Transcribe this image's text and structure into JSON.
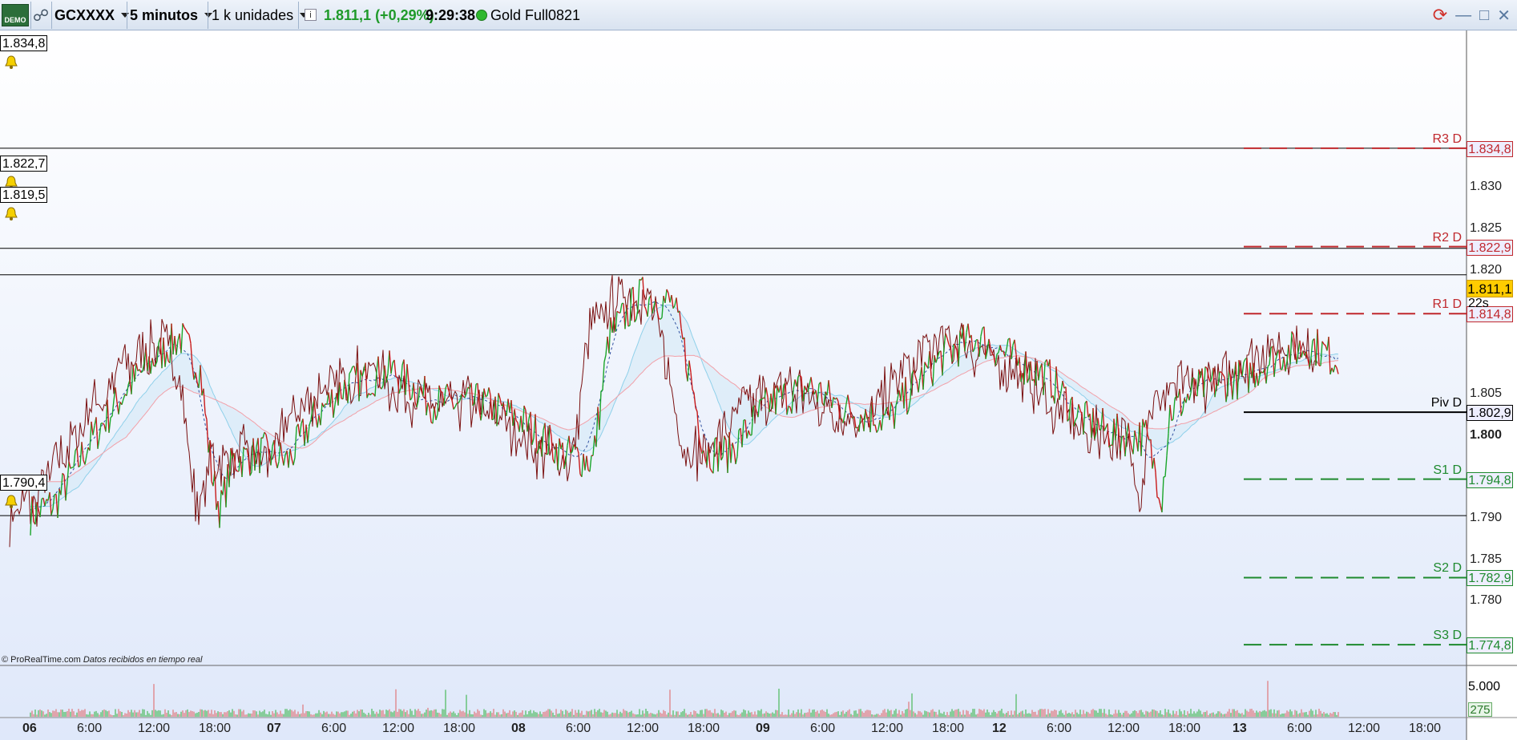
{
  "toolbar": {
    "demo_label": "DEMO",
    "ticker": "GCXXXX",
    "timeframe": "5 minutos",
    "units": "1 k unidades",
    "info_label": "i",
    "price_change": "1.811,1 (+0,29%)",
    "time": "9:29:38",
    "instrument": "Gold Full0821",
    "colors": {
      "up": "#1f9a2a",
      "status": "#2eb82e"
    }
  },
  "levels": {
    "alert_1": "1.834,8",
    "alert_2": "1.822,7",
    "alert_3": "1.819,5",
    "alert_4": "1.790,4"
  },
  "pivots": [
    {
      "label": "R3 D",
      "value": "1.834,8",
      "price": 1834.8,
      "color": "#c0282d"
    },
    {
      "label": "R2 D",
      "value": "1.822,9",
      "price": 1822.9,
      "color": "#c0282d"
    },
    {
      "label": "R1 D",
      "value": "1.814,8",
      "price": 1814.8,
      "color": "#c0282d"
    },
    {
      "label": "Piv D",
      "value": "1.802,9",
      "price": 1802.9,
      "color": "#000000"
    },
    {
      "label": "S1 D",
      "value": "1.794,8",
      "price": 1794.8,
      "color": "#1e8a2e"
    },
    {
      "label": "S2 D",
      "value": "1.782,9",
      "price": 1782.9,
      "color": "#1e8a2e"
    },
    {
      "label": "S3 D",
      "value": "1.774,8",
      "price": 1774.8,
      "color": "#1e8a2e"
    }
  ],
  "price_axis": {
    "ticks": [
      {
        "label": "1.830",
        "value": 1830
      },
      {
        "label": "1.825",
        "value": 1825
      },
      {
        "label": "1.820",
        "value": 1820
      },
      {
        "label": "1.805",
        "value": 1805
      },
      {
        "label": "1.800",
        "value": 1800
      },
      {
        "label": "1.790",
        "value": 1790
      },
      {
        "label": "1.785",
        "value": 1785
      },
      {
        "label": "1.780",
        "value": 1780
      }
    ],
    "current_price": "1.811,1",
    "countdown": "22s"
  },
  "volume": {
    "axis_label": "5.000",
    "current": "275"
  },
  "time_axis": [
    {
      "label": "06",
      "day": true
    },
    {
      "label": "6:00"
    },
    {
      "label": "12:00"
    },
    {
      "label": "18:00"
    },
    {
      "label": "07",
      "day": true
    },
    {
      "label": "6:00"
    },
    {
      "label": "12:00"
    },
    {
      "label": "18:00"
    },
    {
      "label": "08",
      "day": true
    },
    {
      "label": "6:00"
    },
    {
      "label": "12:00"
    },
    {
      "label": "18:00"
    },
    {
      "label": "09",
      "day": true
    },
    {
      "label": "6:00"
    },
    {
      "label": "12:00"
    },
    {
      "label": "18:00"
    },
    {
      "label": "12",
      "day": true
    },
    {
      "label": "6:00"
    },
    {
      "label": "12:00"
    },
    {
      "label": "18:00"
    },
    {
      "label": "13",
      "day": true
    },
    {
      "label": "6:00"
    },
    {
      "label": "12:00"
    },
    {
      "label": "18:00"
    }
  ],
  "footer": {
    "copyright": "© ProRealTime.com",
    "realtime": "Datos recibidos en tiempo real"
  }
}
